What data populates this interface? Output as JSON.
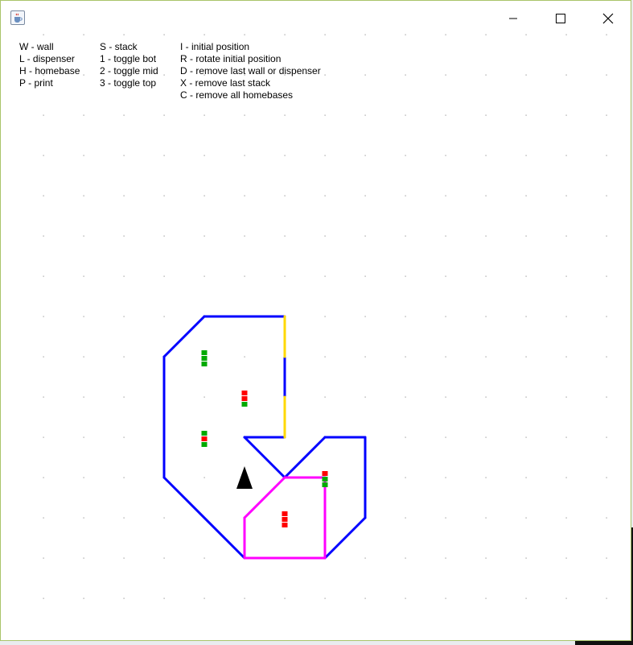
{
  "window": {
    "title": "",
    "icon": "java-coffee-cup-icon",
    "buttons": {
      "minimize": "minimize-icon",
      "maximize": "maximize-icon",
      "close": "close-icon"
    }
  },
  "help": {
    "col1": [
      "W - wall",
      "L - dispenser",
      "H - homebase",
      "P - print"
    ],
    "col2": [
      "S - stack",
      "1 - toggle bot",
      "2 - toggle mid",
      "3 - toggle top"
    ],
    "col3": [
      "I - initial position",
      "R - rotate initial position",
      "D - remove last wall or dispenser",
      "X - remove last stack",
      "C - remove all homebases"
    ]
  },
  "colors": {
    "wall": "#0000ff",
    "dispenser": "#ffd800",
    "homebase": "#ff00ff",
    "stack_red": "#ff0000",
    "stack_green": "#00aa00",
    "robot": "#000000",
    "grid_dot": "#9a9a9a"
  },
  "field": {
    "grid_spacing_cells": 1,
    "walls": [
      [
        [
          4,
          7
        ],
        [
          3,
          8
        ]
      ],
      [
        [
          3,
          8
        ],
        [
          3,
          11
        ]
      ],
      [
        [
          3,
          11
        ],
        [
          5,
          13
        ]
      ],
      [
        [
          4,
          7
        ],
        [
          6,
          7
        ]
      ],
      [
        [
          6,
          8
        ],
        [
          6,
          9
        ]
      ],
      [
        [
          5,
          10
        ],
        [
          6,
          10
        ]
      ],
      [
        [
          5,
          10
        ],
        [
          6,
          11
        ]
      ],
      [
        [
          6,
          11
        ],
        [
          7,
          10
        ]
      ],
      [
        [
          7,
          10
        ],
        [
          8,
          10
        ]
      ],
      [
        [
          8,
          10
        ],
        [
          8,
          12
        ]
      ],
      [
        [
          8,
          12
        ],
        [
          7,
          13
        ]
      ]
    ],
    "dispensers": [
      [
        [
          6,
          7
        ],
        [
          6,
          8
        ]
      ],
      [
        [
          6,
          9
        ],
        [
          6,
          10
        ]
      ]
    ],
    "homebases": [
      [
        [
          6,
          11
        ],
        [
          7,
          11
        ]
      ],
      [
        [
          7,
          11
        ],
        [
          7,
          13
        ]
      ],
      [
        [
          7,
          13
        ],
        [
          5,
          13
        ]
      ],
      [
        [
          5,
          13
        ],
        [
          5,
          12
        ]
      ],
      [
        [
          5,
          12
        ],
        [
          6,
          11
        ]
      ]
    ],
    "stacks": [
      {
        "cell": [
          4,
          8
        ],
        "levels": [
          "green",
          "green",
          "green"
        ]
      },
      {
        "cell": [
          5,
          9
        ],
        "levels": [
          "red",
          "red",
          "green"
        ]
      },
      {
        "cell": [
          4,
          10
        ],
        "levels": [
          "green",
          "red",
          "green"
        ]
      },
      {
        "cell": [
          7,
          11
        ],
        "levels": [
          "red",
          "green",
          "green"
        ]
      },
      {
        "cell": [
          6,
          12
        ],
        "levels": [
          "red",
          "red",
          "red"
        ]
      }
    ],
    "robot": {
      "cell": [
        5,
        11
      ],
      "heading": "up"
    }
  }
}
